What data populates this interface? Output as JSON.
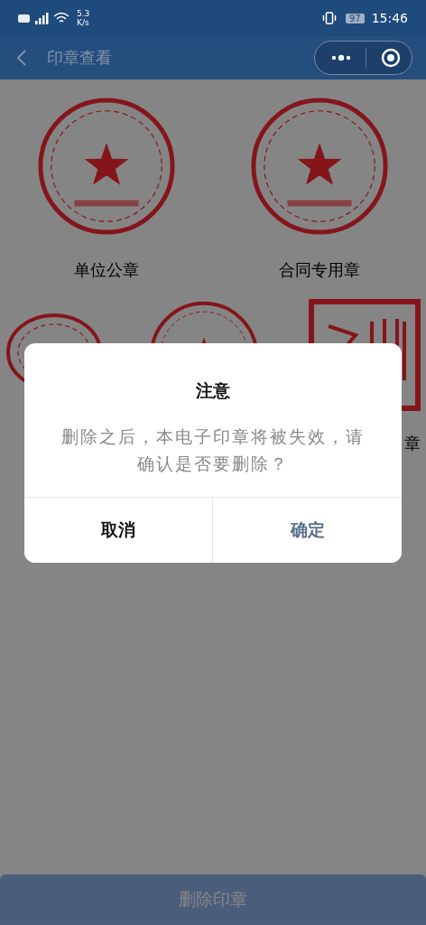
{
  "status_bar": {
    "network_speed": "5.3",
    "speed_unit": "K/s",
    "battery": "97",
    "time": "15:46"
  },
  "nav": {
    "title": "印章查看"
  },
  "seals": [
    {
      "kind": "round",
      "label": "单位公章"
    },
    {
      "kind": "round",
      "label": "合同专用章"
    },
    {
      "kind": "oval"
    },
    {
      "kind": "round"
    },
    {
      "kind": "square",
      "label": "章"
    }
  ],
  "dialog": {
    "title": "注意",
    "message": "删除之后，本电子印章将被失效，请确认是否要删除？",
    "buttons": [
      {
        "kind": "cancel",
        "label": "取消"
      },
      {
        "kind": "confirm",
        "label": "确定"
      }
    ]
  },
  "footer_button": {
    "label": "删除印章",
    "disabled": true
  }
}
